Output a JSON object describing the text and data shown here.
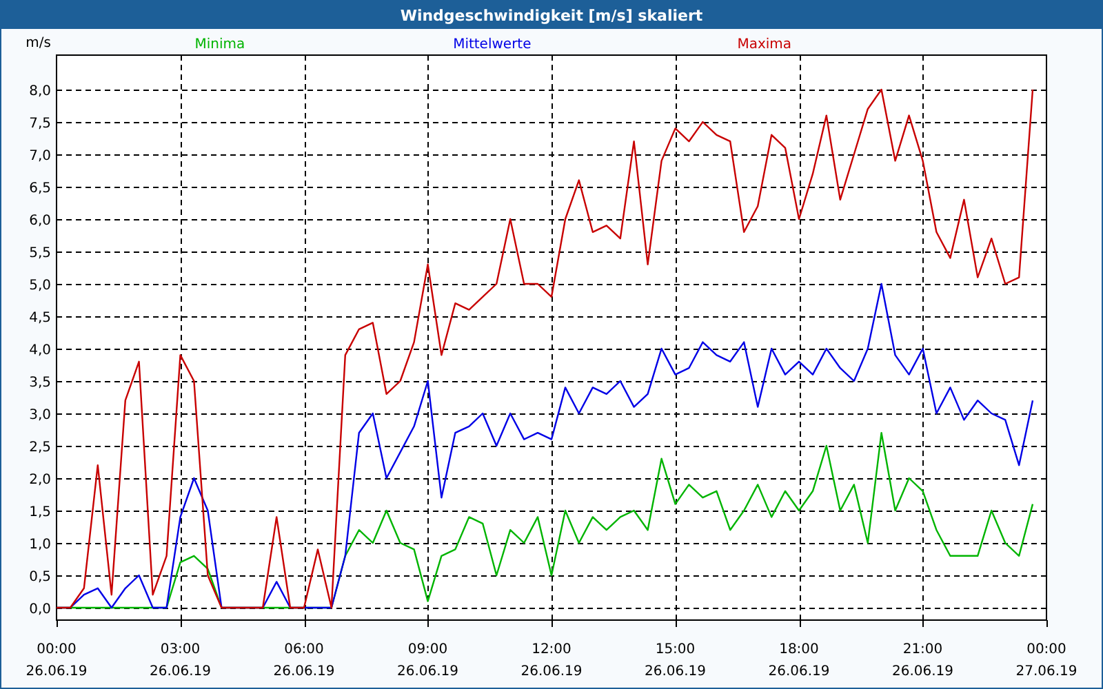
{
  "chart": {
    "chart_data": {
      "type": "line",
      "title": "Windgeschwindigkeit [m/s] skaliert",
      "ylabel": "m/s",
      "categories": [
        "00:00\n26.06.19",
        null,
        null,
        null,
        null,
        null,
        null,
        null,
        null,
        "03:00\n26.06.19",
        null,
        null,
        null,
        null,
        null,
        null,
        null,
        null,
        "06:00\n26.06.19",
        null,
        null,
        null,
        null,
        null,
        null,
        null,
        null,
        "09:00\n26.06.19",
        null,
        null,
        null,
        null,
        null,
        null,
        null,
        null,
        "12:00\n26.06.19",
        null,
        null,
        null,
        null,
        null,
        null,
        null,
        null,
        "15:00\n26.06.19",
        null,
        null,
        null,
        null,
        null,
        null,
        null,
        null,
        "18:00\n26.06.19",
        null,
        null,
        null,
        null,
        null,
        null,
        null,
        null,
        "21:00\n26.06.19",
        null,
        null,
        null,
        null,
        null,
        null,
        null,
        null,
        "00:00\n27.06.19"
      ],
      "series": [
        {
          "name": "Minima",
          "color": "#00b400",
          "values": [
            0,
            0,
            0,
            0,
            0,
            0,
            0,
            0,
            0,
            0.7,
            0.8,
            0.6,
            0,
            0,
            0,
            0,
            0,
            0,
            0,
            0,
            0,
            0.8,
            1.2,
            1.0,
            1.5,
            1.0,
            0.9,
            0.1,
            0.8,
            0.9,
            1.4,
            1.3,
            0.5,
            1.2,
            1.0,
            1.4,
            0.5,
            1.5,
            1.0,
            1.4,
            1.2,
            1.4,
            1.5,
            1.2,
            2.3,
            1.6,
            1.9,
            1.7,
            1.8,
            1.2,
            1.5,
            1.9,
            1.4,
            1.8,
            1.5,
            1.8,
            2.5,
            1.5,
            1.9,
            1.0,
            2.7,
            1.5,
            2.0,
            1.8,
            1.2,
            0.8,
            0.8,
            0.8,
            1.5,
            1.0,
            0.8,
            1.6,
            null
          ]
        },
        {
          "name": "Mittelwerte",
          "color": "#0000e6",
          "values": [
            0,
            0,
            0.2,
            0.3,
            0,
            0.3,
            0.5,
            0,
            0,
            1.4,
            2.0,
            1.5,
            0,
            0,
            0,
            0,
            0.4,
            0,
            0,
            0,
            0,
            0.8,
            2.7,
            3.0,
            2.0,
            2.4,
            2.8,
            3.5,
            1.7,
            2.7,
            2.8,
            3.0,
            2.5,
            3.0,
            2.6,
            2.7,
            2.6,
            3.4,
            3.0,
            3.4,
            3.3,
            3.5,
            3.1,
            3.3,
            4.0,
            3.6,
            3.7,
            4.1,
            3.9,
            3.8,
            4.1,
            3.1,
            4.0,
            3.6,
            3.8,
            3.6,
            4.0,
            3.7,
            3.5,
            4.0,
            5.0,
            3.9,
            3.6,
            4.0,
            3.0,
            3.4,
            2.9,
            3.2,
            3.0,
            2.9,
            2.2,
            3.2,
            null
          ]
        },
        {
          "name": "Maxima",
          "color": "#c80000",
          "values": [
            0,
            0,
            0.3,
            2.2,
            0.2,
            3.2,
            3.8,
            0.2,
            0.8,
            3.9,
            3.5,
            0.5,
            0,
            0,
            0,
            0,
            1.4,
            0,
            0,
            0.9,
            0,
            3.9,
            4.3,
            4.4,
            3.3,
            3.5,
            4.1,
            5.3,
            3.9,
            4.7,
            4.6,
            4.8,
            5.0,
            6.0,
            5.0,
            5.0,
            4.8,
            6.0,
            6.6,
            5.8,
            5.9,
            5.7,
            7.2,
            5.3,
            6.9,
            7.4,
            7.2,
            7.5,
            7.3,
            7.2,
            5.8,
            6.2,
            7.3,
            7.1,
            6.0,
            6.7,
            7.6,
            6.3,
            7.0,
            7.7,
            8.0,
            6.9,
            7.6,
            6.9,
            5.8,
            5.4,
            6.3,
            5.1,
            5.7,
            5.0,
            5.1,
            8.0,
            null
          ]
        }
      ],
      "ylim": [
        0,
        8
      ],
      "grid": true,
      "yticks": [
        {
          "value": 0,
          "label": "0,0"
        },
        {
          "value": 0.5,
          "label": "0,5"
        },
        {
          "value": 1,
          "label": "1,0"
        },
        {
          "value": 1.5,
          "label": "1,5"
        },
        {
          "value": 2,
          "label": "2,0"
        },
        {
          "value": 2.5,
          "label": "2,5"
        },
        {
          "value": 3,
          "label": "3,0"
        },
        {
          "value": 3.5,
          "label": "3,5"
        },
        {
          "value": 4,
          "label": "4,0"
        },
        {
          "value": 4.5,
          "label": "4,5"
        },
        {
          "value": 5,
          "label": "5,0"
        },
        {
          "value": 5.5,
          "label": "5,5"
        },
        {
          "value": 6,
          "label": "6,0"
        },
        {
          "value": 6.5,
          "label": "6,5"
        },
        {
          "value": 7,
          "label": "7,0"
        },
        {
          "value": 7.5,
          "label": "7,5"
        },
        {
          "value": 8,
          "label": "8,0"
        }
      ]
    }
  }
}
